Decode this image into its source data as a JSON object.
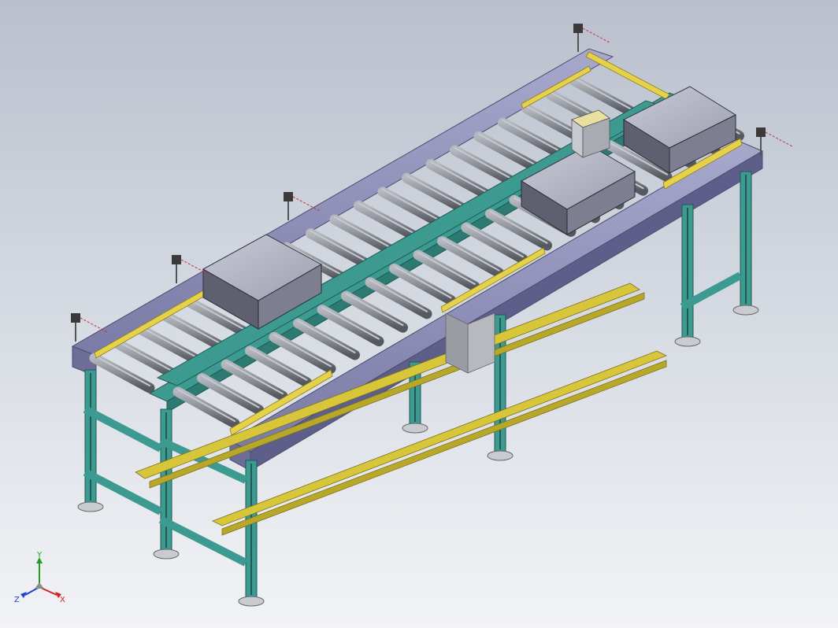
{
  "viewport": {
    "colors": {
      "frame_profile": "#3d9a90",
      "frame_dark": "#1f5a55",
      "side_plate": "#8f90b8",
      "side_plate_dark": "#6a6b94",
      "roller": "#8c8f96",
      "roller_dark": "#5a5d63",
      "crossbar_yellow": "#e6d24a",
      "guide_yellow": "#d8c63a",
      "tote_light": "#b4b6c4",
      "tote_dark": "#5e6070",
      "foot": "#c9cbd1",
      "sensor": "#3a3a3a",
      "laser": "#c8303a"
    }
  },
  "triad": {
    "y_label": "Y",
    "x_label": "X",
    "z_label": "Z",
    "colors": {
      "x": "#d02020",
      "y": "#20a020",
      "z": "#2040d0"
    }
  }
}
